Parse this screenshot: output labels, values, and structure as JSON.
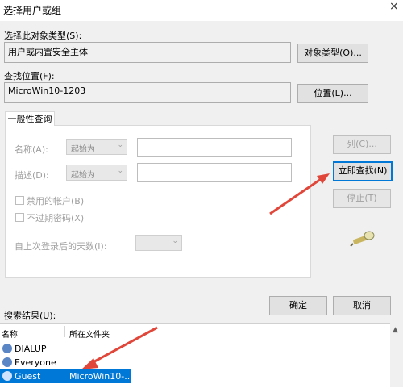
{
  "window": {
    "title": "选择用户或组"
  },
  "object_type": {
    "label": "选择此对象类型(S):",
    "value": "用户或内置安全主体",
    "button": "对象类型(O)..."
  },
  "location": {
    "label": "查找位置(F):",
    "value": "MicroWin10-1203",
    "button": "位置(L)..."
  },
  "query": {
    "tab": "一般性查询",
    "name_label": "名称(A):",
    "desc_label": "描述(D):",
    "starts_with": "起始为",
    "disabled_accounts": "禁用的帐户(B)",
    "no_expire_pwd": "不过期密码(X)",
    "days_since_login": "自上次登录后的天数(I):"
  },
  "buttons": {
    "columns": "列(C)...",
    "find_now": "立即查找(N)",
    "stop": "停止(T)",
    "ok": "确定",
    "cancel": "取消"
  },
  "results": {
    "label": "搜索结果(U):",
    "columns": [
      "名称",
      "所在文件夹"
    ],
    "rows": [
      {
        "name": "DIALUP",
        "folder": ""
      },
      {
        "name": "Everyone",
        "folder": ""
      },
      {
        "name": "Guest",
        "folder": "MicroWin10-..."
      }
    ],
    "selected_index": 2
  },
  "colors": {
    "accent": "#0078d7",
    "arrow": "#e0473a"
  }
}
